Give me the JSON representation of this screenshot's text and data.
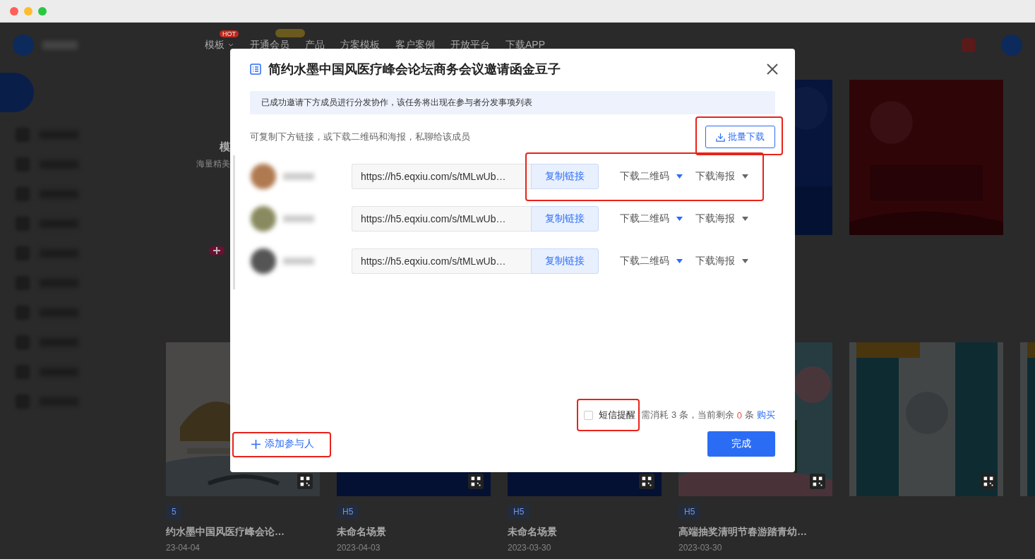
{
  "app_header": {
    "nav": [
      {
        "label": "模板",
        "caret": true,
        "badge": {
          "kind": "hot",
          "text": "HOT"
        }
      },
      {
        "label": "开通会员",
        "caret": false,
        "badge": {
          "kind": "promo"
        }
      },
      {
        "label": "产品",
        "caret": false
      },
      {
        "label": "方案模板",
        "caret": false
      },
      {
        "label": "客户案例",
        "caret": false
      },
      {
        "label": "开放平台",
        "caret": false
      },
      {
        "label": "下载APP",
        "caret": false
      }
    ]
  },
  "feature_panel": {
    "title": "模",
    "subtitle": "海量精美"
  },
  "cards": [
    {
      "tag": "5",
      "title": "约水墨中国风医疗峰会论…",
      "date": "23-04-04"
    },
    {
      "tag": "H5",
      "title": "未命名场景",
      "date": "2023-04-03"
    },
    {
      "tag": "H5",
      "title": "未命名场景",
      "date": "2023-03-30"
    },
    {
      "tag": "H5",
      "title": "高端抽奖清明节春游踏青幼…",
      "date": "2023-03-30"
    }
  ],
  "dialog": {
    "title": "简约水墨中国风医疗峰会论坛商务会议邀请函金豆子",
    "notice": "已成功邀请下方成员进行分发协作，该任务将出现在参与者分发事项列表",
    "hint": "可复制下方链接，或下载二维码和海报，私聊给该成员",
    "batch_button": {
      "label": "批量下载",
      "highlighted": true
    },
    "members": [
      {
        "link": "https://h5.eqxiu.com/s/tMLwUb…",
        "copy_button": "复制链接",
        "qr_menu": "下载二维码",
        "poster_menu": "下载海报",
        "highlighted": true
      },
      {
        "link": "https://h5.eqxiu.com/s/tMLwUb…",
        "copy_button": "复制链接",
        "qr_menu": "下载二维码",
        "poster_menu": "下载海报",
        "highlighted": false
      },
      {
        "link": "https://h5.eqxiu.com/s/tMLwUb…",
        "copy_button": "复制链接",
        "qr_menu": "下载二维码",
        "poster_menu": "下载海报",
        "highlighted": false
      }
    ],
    "sms": {
      "checked": false,
      "highlighted": true,
      "label": "短信提醒",
      "cost": "需消耗 3 条，当前剩余",
      "remaining": "0",
      "unit": "条",
      "buy_link": "购买"
    },
    "add_button": {
      "label": "添加参与人",
      "highlighted": true
    },
    "done_button": "完成"
  }
}
